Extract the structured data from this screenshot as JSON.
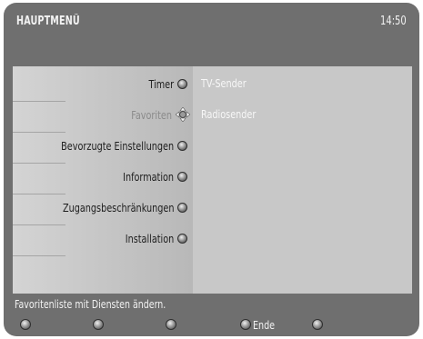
{
  "header": {
    "title": "HAUPTMENÜ",
    "clock": "14:50"
  },
  "menu": {
    "items": [
      {
        "label": "Timer"
      },
      {
        "label": "Favoriten",
        "active": true
      },
      {
        "label": "Bevorzugte Einstellungen"
      },
      {
        "label": "Information"
      },
      {
        "label": "Zugangsbeschränkungen"
      },
      {
        "label": "Installation"
      }
    ]
  },
  "submenu": {
    "items": [
      {
        "label": "TV-Sender"
      },
      {
        "label": "Radiosender"
      }
    ]
  },
  "hint": "Favoritenliste mit Diensten ändern.",
  "softkeys": [
    {
      "label": ""
    },
    {
      "label": ""
    },
    {
      "label": ""
    },
    {
      "label": "Ende"
    },
    {
      "label": ""
    }
  ]
}
